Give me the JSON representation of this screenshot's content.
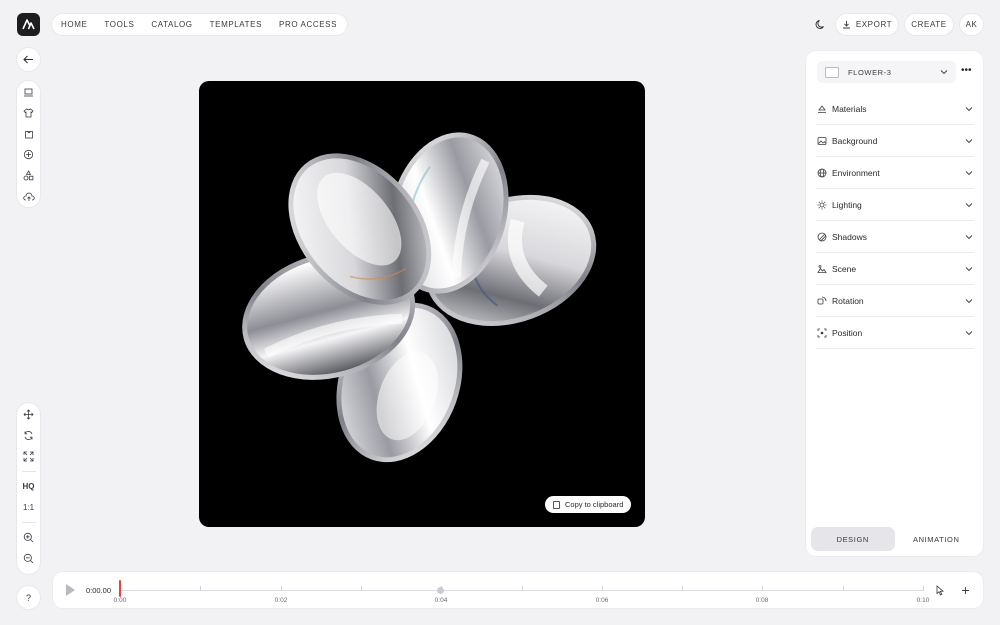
{
  "brand": {
    "logo": "A-logo"
  },
  "nav": {
    "items": [
      "HOME",
      "TOOLS",
      "CATALOG",
      "TEMPLATES",
      "PRO ACCESS"
    ]
  },
  "topbar": {
    "theme_icon": "moon-icon",
    "export_label": "EXPORT",
    "create_label": "CREATE",
    "avatar": "AK"
  },
  "left_tools": {
    "back_icon": "arrow-left-icon",
    "category_icons": [
      "laptop-icon",
      "tshirt-icon",
      "bag-icon",
      "badge-icon",
      "shapes-icon",
      "upload-icon"
    ],
    "view_tools": {
      "icons": [
        "move-icon",
        "rotate-icon",
        "fit-icon"
      ],
      "quality_label": "HQ",
      "ratio_label": "1:1",
      "zoom_icons": [
        "zoom-in-icon",
        "zoom-out-icon"
      ]
    },
    "help_label": "?"
  },
  "canvas": {
    "copy_label": "Copy to clipboard"
  },
  "panel": {
    "object_name": "FLOWER-3",
    "sections": [
      "Materials",
      "Background",
      "Environment",
      "Lighting",
      "Shadows",
      "Scene",
      "Rotation",
      "Position"
    ],
    "tabs": [
      "DESIGN",
      "ANIMATION"
    ],
    "active_tab": "DESIGN"
  },
  "timeline": {
    "current_time": "0:00.00",
    "labels": [
      "0:00",
      "0:02",
      "0:04",
      "0:06",
      "0:08",
      "0:10"
    ],
    "playhead_position": 0,
    "keyframe_time": "0:04"
  },
  "colors": {
    "accent": "#e0463f",
    "background": "#f2f2f4",
    "canvas": "#000000"
  }
}
